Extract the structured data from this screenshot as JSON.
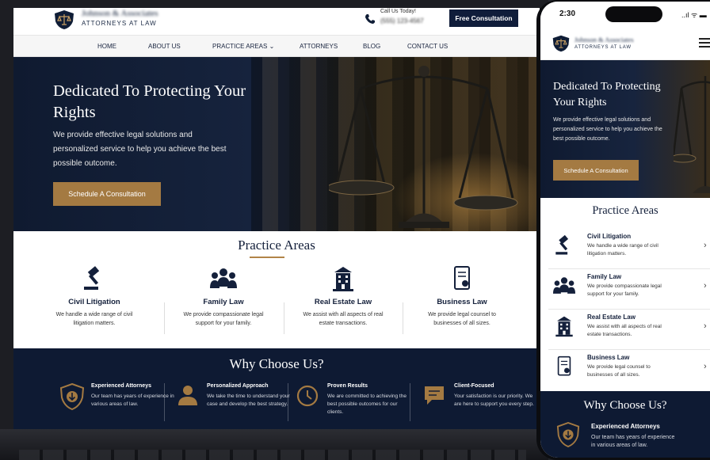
{
  "colors": {
    "navy": "#0e1a33",
    "gold": "#a47a42",
    "accent_line": "#b28447",
    "white": "#ffffff"
  },
  "laptop": {
    "header": {
      "firm_name": "Johnson & Associates",
      "firm_subtitle": "ATTORNEYS AT LAW",
      "call_label": "Call Us Today!",
      "phone_number": "(555) 123-4567",
      "cta_label": "Free Consultation"
    },
    "nav": [
      "HOME",
      "ABOUT US",
      "PRACTICE AREAS ⌄",
      "ATTORNEYS",
      "BLOG",
      "CONTACT US"
    ],
    "hero": {
      "title": "Dedicated To Protecting Your Rights",
      "text": "We provide effective legal solutions and personalized service to help you achieve the best possible outcome.",
      "button": "Schedule A Consultation"
    },
    "practice": {
      "title": "Practice Areas",
      "items": [
        {
          "icon": "gavel-icon",
          "title": "Civil Litigation",
          "text": "We handle a wide range of civil litigation matters."
        },
        {
          "icon": "family-icon",
          "title": "Family Law",
          "text": "We provide compassionate legal support for your family."
        },
        {
          "icon": "building-icon",
          "title": "Real Estate Law",
          "text": "We assist with all aspects of real estate transactions."
        },
        {
          "icon": "document-icon",
          "title": "Business Law",
          "text": "We provide legal counsel to businesses of all sizes."
        }
      ]
    },
    "why": {
      "title": "Why Choose Us?",
      "items": [
        {
          "icon": "shield-icon",
          "title": "Experienced Attorneys",
          "text": "Our team has years of experience in various areas of law."
        },
        {
          "icon": "person-icon",
          "title": "Personalized Approach",
          "text": "We take the time to understand your case and develop the best strategy."
        },
        {
          "icon": "clock-icon",
          "title": "Proven Results",
          "text": "We are committed to achieving the best possible outcomes for our clients."
        },
        {
          "icon": "chat-icon",
          "title": "Client-Focused",
          "text": "Your satisfaction is our priority. We are here to support you every step."
        }
      ]
    }
  },
  "phone": {
    "status": {
      "time": "2:30",
      "signal": "..ıl ᯤ ▬"
    },
    "header": {
      "firm_name": "Johnson & Associates",
      "firm_subtitle": "ATTORNEYS AT LAW"
    },
    "hero": {
      "title": "Dedicated To Protecting Your Rights",
      "text": "We provide effective legal solutions and personalized service to help you achieve the best possible outcome.",
      "button": "Schedule A Consultation"
    },
    "practice": {
      "title": "Practice Areas",
      "items": [
        {
          "icon": "gavel-icon",
          "title": "Civil Litigation",
          "text": "We handle a wide range of civil litigation matters."
        },
        {
          "icon": "family-icon",
          "title": "Family Law",
          "text": "We provide compassionate legal support for your family."
        },
        {
          "icon": "building-icon",
          "title": "Real Estate Law",
          "text": "We assist with all aspects of real estate transactions."
        },
        {
          "icon": "document-icon",
          "title": "Business Law",
          "text": "We provide legal counsel to businesses of all sizes."
        }
      ]
    },
    "why": {
      "title": "Why Choose Us?",
      "item": {
        "icon": "shield-icon",
        "title": "Experienced Attorneys",
        "text": "Our team has years of experience in various areas of law."
      }
    }
  }
}
